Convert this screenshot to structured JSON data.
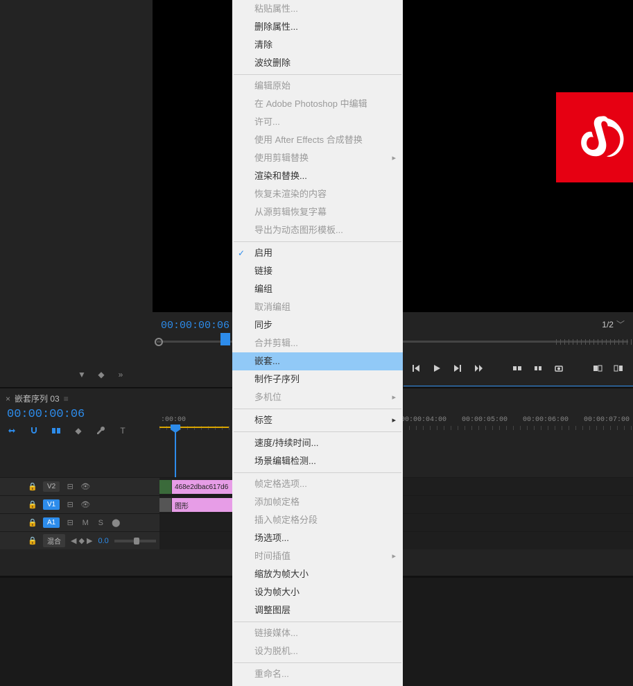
{
  "viewer": {
    "timecode": "00:00:00:06",
    "zoom": "1/2"
  },
  "timeline": {
    "sequence_name": "嵌套序列 03",
    "timecode": "00:00:00:06",
    "ruler": [
      ":00:00",
      "00:00:04:00",
      "00:00:05:00",
      "00:00:06:00",
      "00:00:07:00"
    ],
    "tracks": {
      "v2": {
        "label": "V2",
        "clip": "468e2dbac617d6"
      },
      "v1": {
        "label": "V1",
        "clip": "图形"
      },
      "a1": {
        "label": "A1",
        "mute": "M",
        "solo": "S"
      },
      "mix": {
        "label": "混合",
        "value": "0.0"
      }
    }
  },
  "context_menu": {
    "items": [
      {
        "label": "粘贴属性...",
        "disabled": true
      },
      {
        "label": "删除属性...",
        "disabled": false
      },
      {
        "label": "清除",
        "disabled": false
      },
      {
        "label": "波纹删除",
        "disabled": false
      },
      {
        "sep": true
      },
      {
        "label": "编辑原始",
        "disabled": true
      },
      {
        "label": "在 Adobe Photoshop 中编辑",
        "disabled": true
      },
      {
        "label": "许可...",
        "disabled": true
      },
      {
        "label": "使用 After Effects 合成替换",
        "disabled": true
      },
      {
        "label": "使用剪辑替换",
        "disabled": true,
        "submenu": true
      },
      {
        "label": "渲染和替换...",
        "disabled": false
      },
      {
        "label": "恢复未渲染的内容",
        "disabled": true
      },
      {
        "label": "从源剪辑恢复字幕",
        "disabled": true
      },
      {
        "label": "导出为动态图形模板...",
        "disabled": true
      },
      {
        "sep": true
      },
      {
        "label": "启用",
        "disabled": false,
        "checked": true
      },
      {
        "label": "链接",
        "disabled": false
      },
      {
        "label": "编组",
        "disabled": false
      },
      {
        "label": "取消编组",
        "disabled": true
      },
      {
        "label": "同步",
        "disabled": false
      },
      {
        "label": "合并剪辑...",
        "disabled": true
      },
      {
        "label": "嵌套...",
        "disabled": false,
        "selected": true
      },
      {
        "label": "制作子序列",
        "disabled": false
      },
      {
        "label": "多机位",
        "disabled": true,
        "submenu": true
      },
      {
        "sep": true
      },
      {
        "label": "标签",
        "disabled": false,
        "submenu": true
      },
      {
        "sep": true
      },
      {
        "label": "速度/持续时间...",
        "disabled": false
      },
      {
        "label": "场景编辑检测...",
        "disabled": false
      },
      {
        "sep": true
      },
      {
        "label": "帧定格选项...",
        "disabled": true
      },
      {
        "label": "添加帧定格",
        "disabled": true
      },
      {
        "label": "插入帧定格分段",
        "disabled": true
      },
      {
        "label": "场选项...",
        "disabled": false
      },
      {
        "label": "时间插值",
        "disabled": true,
        "submenu": true
      },
      {
        "label": "缩放为帧大小",
        "disabled": false
      },
      {
        "label": "设为帧大小",
        "disabled": false
      },
      {
        "label": "调整图层",
        "disabled": false
      },
      {
        "sep": true
      },
      {
        "label": "链接媒体...",
        "disabled": true
      },
      {
        "label": "设为脱机...",
        "disabled": true
      },
      {
        "sep": true
      },
      {
        "label": "重命名...",
        "disabled": true
      }
    ]
  }
}
